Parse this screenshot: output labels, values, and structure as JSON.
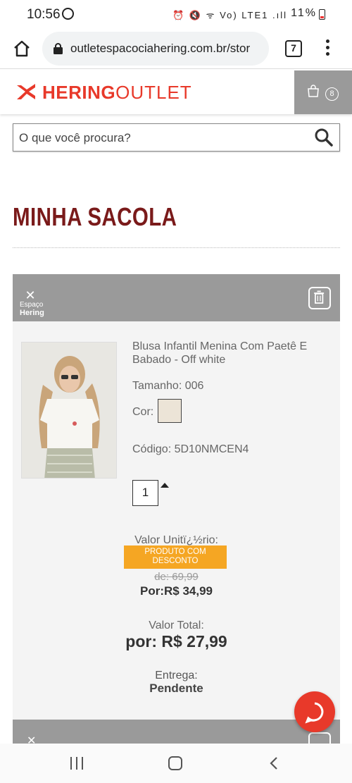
{
  "status": {
    "time": "10:56",
    "right_icons": "⏰ 🔇 ᯤ Vo) LTE1 .ıll",
    "battery": "11%"
  },
  "browser": {
    "url": "outletespacociahering.com.br/stor",
    "tab_count": "7"
  },
  "header": {
    "logo_brand": "HERING",
    "logo_suffix": "OUTLET",
    "cart_count": "8"
  },
  "search": {
    "placeholder": "O que você procura?"
  },
  "page": {
    "title": "MINHA SACOLA"
  },
  "cart_item": {
    "brand_line1": "Espaço",
    "brand_line2": "Hering",
    "name": "Blusa Infantil Menina Com Paetê E Babado - Off white",
    "size": "Tamanho: 006",
    "color_label": "Cor:",
    "color_swatch": "#ece4d7",
    "code": "Código: 5D10NMCEN4",
    "quantity": "1",
    "unit_label": "Valor Unitï¿½rio:",
    "discount_badge": "PRODUTO COM DESCONTO",
    "old_price": "de: 69,99",
    "new_price": "Por:R$ 34,99",
    "total_label": "Valor Total:",
    "total_price": "por: R$ 27,99",
    "delivery_label": "Entrega:",
    "delivery_value": "Pendente"
  },
  "colors": {
    "brand_red": "#e8392a",
    "title_red": "#7a1a1a",
    "badge_orange": "#f5a623",
    "header_gray": "#9a9a9a"
  }
}
